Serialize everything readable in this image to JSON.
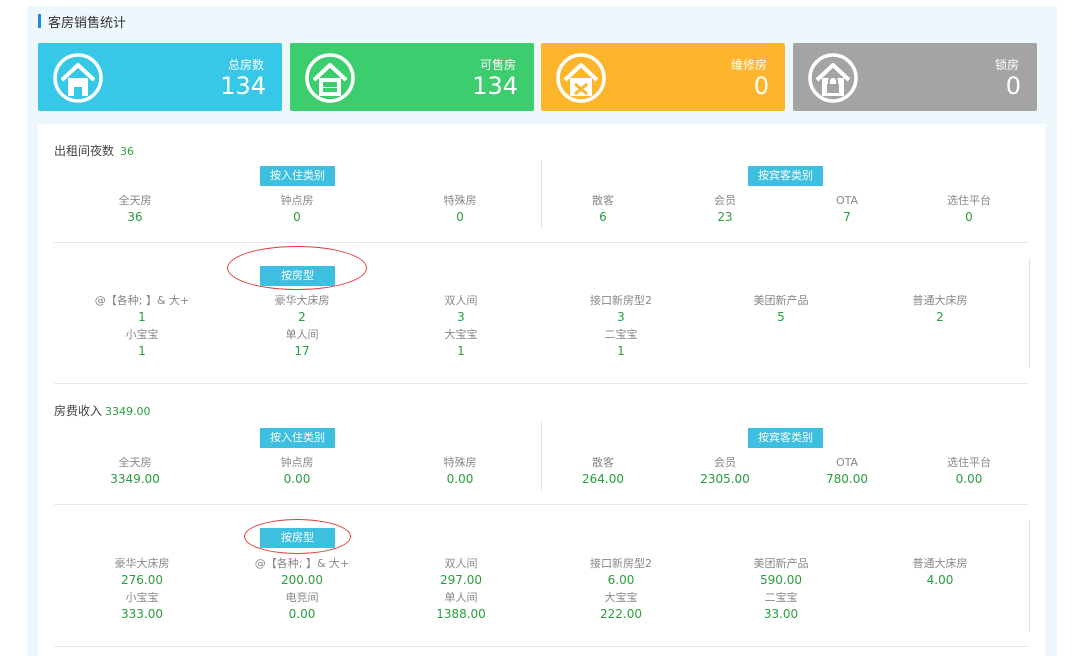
{
  "header": {
    "title": "客房销售统计"
  },
  "cards": [
    {
      "label": "总房数",
      "value": "134",
      "color": "#36c8e6",
      "icon": "house-icon"
    },
    {
      "label": "可售房",
      "value": "134",
      "color": "#3cce6e",
      "icon": "bed-house-icon"
    },
    {
      "label": "维修房",
      "value": "0",
      "color": "#fdb52b",
      "icon": "tools-house-icon"
    },
    {
      "label": "锁房",
      "value": "0",
      "color": "#a4a4a4",
      "icon": "lock-house-icon"
    }
  ],
  "nights": {
    "title": "出租间夜数",
    "total": "36",
    "by_checkin_tag": "按入住类别",
    "by_guest_tag": "按宾客类别",
    "checkin": [
      {
        "name": "全天房",
        "value": "36"
      },
      {
        "name": "钟点房",
        "value": "0"
      },
      {
        "name": "特殊房",
        "value": "0"
      }
    ],
    "guest": [
      {
        "name": "散客",
        "value": "6"
      },
      {
        "name": "会员",
        "value": "23"
      },
      {
        "name": "OTA",
        "value": "7"
      },
      {
        "name": "选住平台",
        "value": "0"
      }
    ],
    "by_room_tag": "按房型",
    "room": [
      {
        "name": "@【各种; 】& 大+",
        "value": "1"
      },
      {
        "name": "豪华大床房",
        "value": "2"
      },
      {
        "name": "双人间",
        "value": "3"
      },
      {
        "name": "接口新房型2",
        "value": "3"
      },
      {
        "name": "美团新产品",
        "value": "5"
      },
      {
        "name": "普通大床房",
        "value": "2"
      },
      {
        "name": "小宝宝",
        "value": "1"
      },
      {
        "name": "单人间",
        "value": "17"
      },
      {
        "name": "大宝宝",
        "value": "1"
      },
      {
        "name": "二宝宝",
        "value": "1"
      }
    ]
  },
  "revenue": {
    "title": "房费收入",
    "total": "3349.00",
    "by_checkin_tag": "按入住类别",
    "by_guest_tag": "按宾客类别",
    "checkin": [
      {
        "name": "全天房",
        "value": "3349.00"
      },
      {
        "name": "钟点房",
        "value": "0.00"
      },
      {
        "name": "特殊房",
        "value": "0.00"
      }
    ],
    "guest": [
      {
        "name": "散客",
        "value": "264.00"
      },
      {
        "name": "会员",
        "value": "2305.00"
      },
      {
        "name": "OTA",
        "value": "780.00"
      },
      {
        "name": "选住平台",
        "value": "0.00"
      }
    ],
    "by_room_tag": "按房型",
    "room": [
      {
        "name": "豪华大床房",
        "value": "276.00"
      },
      {
        "name": "@【各种; 】& 大+",
        "value": "200.00"
      },
      {
        "name": "双人间",
        "value": "297.00"
      },
      {
        "name": "接口新房型2",
        "value": "6.00"
      },
      {
        "name": "美团新产品",
        "value": "590.00"
      },
      {
        "name": "普通大床房",
        "value": "4.00"
      },
      {
        "name": "小宝宝",
        "value": "333.00"
      },
      {
        "name": "电竞间",
        "value": "0.00"
      },
      {
        "name": "单人间",
        "value": "1388.00"
      },
      {
        "name": "大宝宝",
        "value": "222.00"
      },
      {
        "name": "二宝宝",
        "value": "33.00"
      }
    ]
  }
}
